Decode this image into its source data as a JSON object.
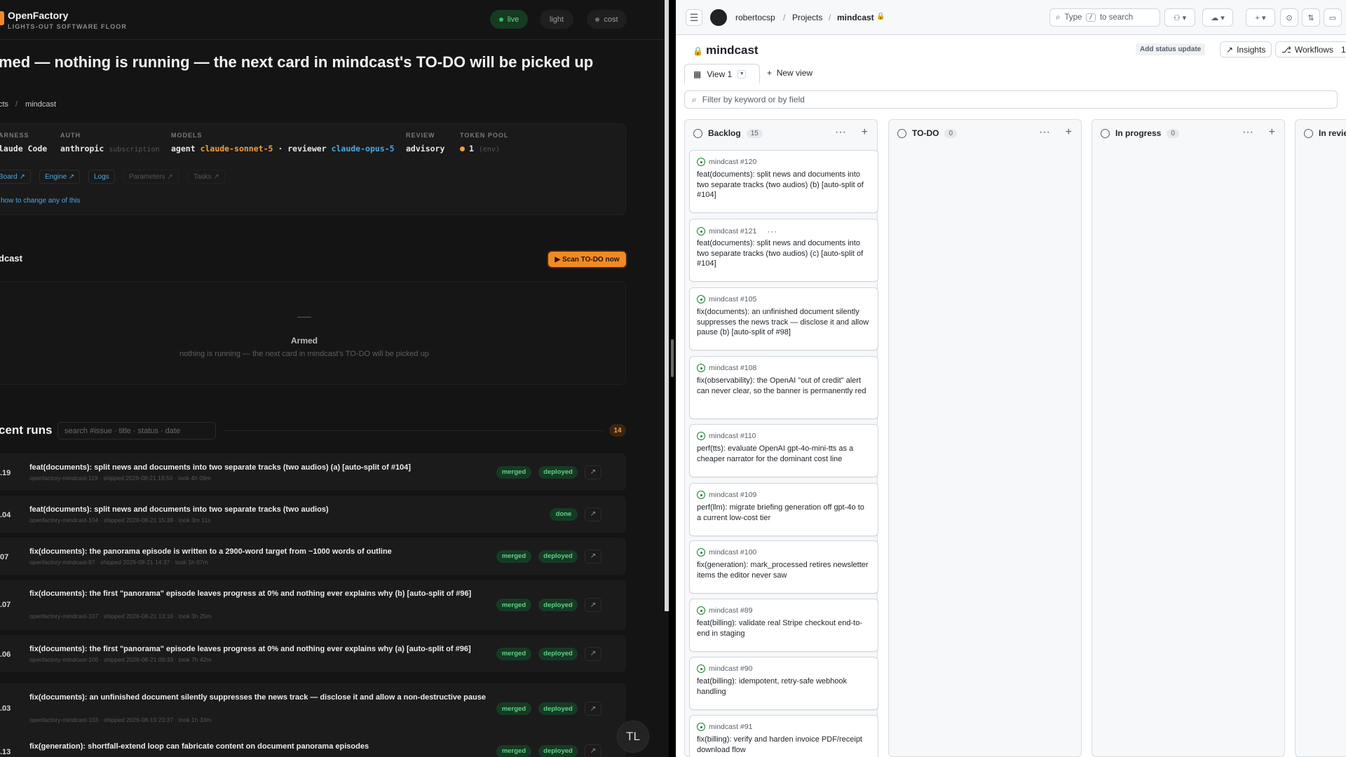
{
  "left": {
    "brand": "OpenFactory",
    "brand_sub": "LIGHTS-OUT SOFTWARE FLOOR",
    "pills": {
      "live": "live",
      "light": "light",
      "cost": "cost"
    },
    "headline": "med — nothing is running — the next card in mindcast's TO-DO will be picked up",
    "breadcrumb": {
      "parent": "cts",
      "sep": "/",
      "current": "mindcast"
    },
    "settings": {
      "harness": {
        "label": "ARNESS",
        "value": "laude Code"
      },
      "auth": {
        "label": "AUTH",
        "value": "anthropic",
        "note": "subscription"
      },
      "models": {
        "label": "MODELS",
        "agent_prefix": "agent",
        "agent": "claude-sonnet-5",
        "sep": "·",
        "reviewer_prefix": "reviewer",
        "reviewer": "claude-opus-5"
      },
      "review": {
        "label": "REVIEW",
        "value": "advisory"
      },
      "token_pool": {
        "label": "TOKEN POOL",
        "value": "1",
        "note": "(env)"
      }
    },
    "tool_buttons": [
      "Board ↗",
      "Engine ↗",
      "Logs",
      "Parameters ↗",
      "Tasks ↗"
    ],
    "how_link": "how to change any of this",
    "section_title": "dcast",
    "scan_button": "▶ Scan TO-DO now",
    "armed": {
      "dash": "—",
      "title": "Armed",
      "subtitle": "nothing is running — the next card in mindcast's TO-DO will be picked up"
    },
    "runs_title": "cent runs",
    "runs_search_placeholder": "search #issue · title · status · date",
    "runs_count": "14",
    "runs": [
      {
        "num": ".19",
        "title": "feat(documents): split news and documents into two separate tracks (two audios) (a) [auto-split of #104]",
        "meta": "openfactory-mindcast-119 · shipped 2026-08-21 19:50 · took 4h 09m",
        "badges": [
          "merged",
          "deployed"
        ]
      },
      {
        "num": ".04",
        "title": "feat(documents): split news and documents into two separate tracks (two audios)",
        "meta": "openfactory-mindcast-104 · shipped 2026-08-21 15:38 · took 3m 11s",
        "badges": [
          "done"
        ]
      },
      {
        "num": "07",
        "title": "fix(documents): the panorama episode is written to a 2900-word target from ~1000 words of outline",
        "meta": "openfactory-mindcast-97 · shipped 2026-08-21 14:37 · took 1h 07m",
        "badges": [
          "merged",
          "deployed"
        ]
      },
      {
        "num": ".07",
        "title": "fix(documents): the first \"panorama\" episode leaves progress at 0% and nothing ever explains why (b) [auto-split of #96]",
        "meta": "openfactory-mindcast-107 · shipped 2026-08-21 13:16 · took 3h 25m",
        "badges": [
          "merged",
          "deployed"
        ]
      },
      {
        "num": ".06",
        "title": "fix(documents): the first \"panorama\" episode leaves progress at 0% and nothing ever explains why (a) [auto-split of #96]",
        "meta": "openfactory-mindcast-106 · shipped 2026-08-21 09:33 · took 7h 42m",
        "badges": [
          "merged",
          "deployed"
        ]
      },
      {
        "num": ".03",
        "title": "fix(documents): an unfinished document silently suppresses the news track — disclose it and allow a non-destructive pause",
        "meta": "openfactory-mindcast-103 · shipped 2026-08-19 23:37 · took 1h 33m",
        "badges": [
          "merged",
          "deployed"
        ]
      },
      {
        "num": ".13",
        "title": "fix(generation): shortfall-extend loop can fabricate content on document panorama episodes",
        "meta": "",
        "badges": [
          "merged",
          "deployed"
        ]
      }
    ],
    "tl_button": "TL"
  },
  "right": {
    "crumbs": {
      "owner": "robertocsp",
      "sep": "/",
      "projects": "Projects",
      "repo": "mindcast"
    },
    "search": {
      "prefix": "Type",
      "key": "/",
      "suffix": "to search"
    },
    "project_title": "mindcast",
    "status_button": "Add status update",
    "insights": "Insights",
    "workflows": "Workflows",
    "workflows_count": "1",
    "view_tab": "View 1",
    "new_view": "New view",
    "filter_placeholder": "Filter by keyword or by field",
    "columns": [
      {
        "name": "Backlog",
        "count": "15"
      },
      {
        "name": "TO-DO",
        "count": "0"
      },
      {
        "name": "In progress",
        "count": "0"
      },
      {
        "name": "In revie",
        "count": ""
      }
    ],
    "cards": [
      {
        "ref": "mindcast #120",
        "title": "feat(documents): split news and documents into two separate tracks (two audios) (b) [auto-split of #104]"
      },
      {
        "ref": "mindcast #121",
        "title": "feat(documents): split news and documents into two separate tracks (two audios) (c) [auto-split of #104]",
        "menu": "···"
      },
      {
        "ref": "mindcast #105",
        "title": "fix(documents): an unfinished document silently suppresses the news track — disclose it and allow pause (b) [auto-split of #98]"
      },
      {
        "ref": "mindcast #108",
        "title": "fix(observability): the OpenAI \"out of credit\" alert can never clear, so the banner is permanently red"
      },
      {
        "ref": "mindcast #110",
        "title": "perf(tts): evaluate OpenAI gpt-4o-mini-tts as a cheaper narrator for the dominant cost line"
      },
      {
        "ref": "mindcast #109",
        "title": "perf(llm): migrate briefing generation off gpt-4o to a current low-cost tier"
      },
      {
        "ref": "mindcast #100",
        "title": "fix(generation): mark_processed retires newsletter items the editor never saw"
      },
      {
        "ref": "mindcast #89",
        "title": "feat(billing): validate real Stripe checkout end-to-end in staging"
      },
      {
        "ref": "mindcast #90",
        "title": "feat(billing): idempotent, retry-safe webhook handling"
      },
      {
        "ref": "mindcast #91",
        "title": "fix(billing): verify and harden invoice PDF/receipt download flow"
      }
    ]
  },
  "colors": {
    "accent_orange": "#f08a24",
    "live_green": "#2fbf5f",
    "link_blue": "#4fa8e0",
    "gh_open_green": "#1a7f37"
  }
}
